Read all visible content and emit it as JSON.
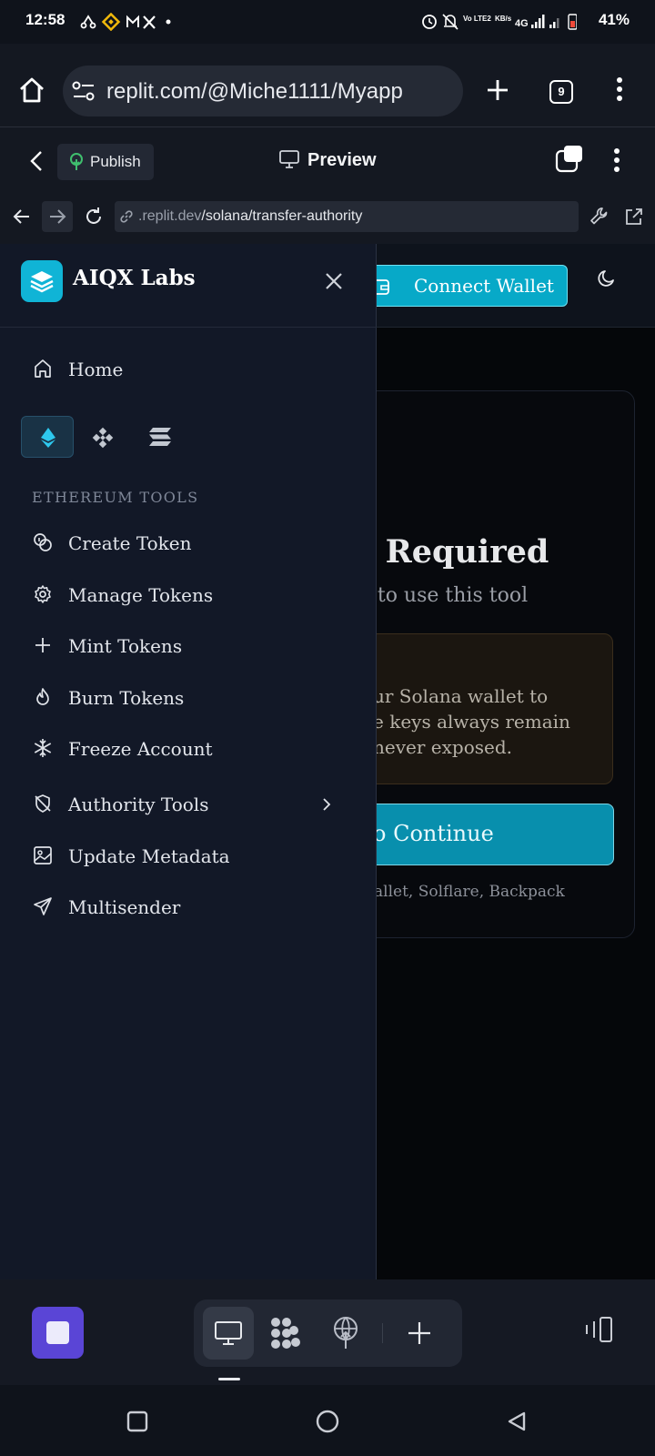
{
  "status_bar": {
    "time": "12:58",
    "battery": "41%"
  },
  "browser": {
    "url": "replit.com/@Miche1111/Myapp",
    "tab_count": "9"
  },
  "replit_toolbar": {
    "publish_label": "Publish",
    "preview_label": "Preview"
  },
  "address_bar": {
    "url_prefix": ".replit.dev",
    "url_path": "/solana/transfer-authority"
  },
  "app_header": {
    "connect_wallet_label": "Connect Wallet"
  },
  "card": {
    "title_fragment": "n Required",
    "subtitle_fragment": "et to use this tool",
    "notice_lines": [
      "ur Solana wallet to",
      "e keys always remain",
      "never exposed."
    ],
    "continue_label": "o Continue",
    "wallets_fragment": "allet, Solflare, Backpack"
  },
  "sidebar": {
    "brand": "AIQX Labs",
    "home_label": "Home",
    "chains": [
      "ethereum-icon",
      "bnb-icon",
      "solana-icon"
    ],
    "section_label": "ETHEREUM TOOLS",
    "items": [
      {
        "label": "Create Token",
        "icon": "coins-icon"
      },
      {
        "label": "Manage Tokens",
        "icon": "gear-icon"
      },
      {
        "label": "Mint Tokens",
        "icon": "plus-icon"
      },
      {
        "label": "Burn Tokens",
        "icon": "flame-icon"
      },
      {
        "label": "Freeze Account",
        "icon": "snowflake-icon"
      },
      {
        "label": "Authority Tools",
        "icon": "shield-off-icon"
      },
      {
        "label": "Update Metadata",
        "icon": "image-icon"
      },
      {
        "label": "Multisender",
        "icon": "send-icon"
      }
    ]
  },
  "colors": {
    "accent_cyan": "#07a9c8",
    "drawer_bg": "#121827",
    "app_square": "#5a45d6"
  }
}
